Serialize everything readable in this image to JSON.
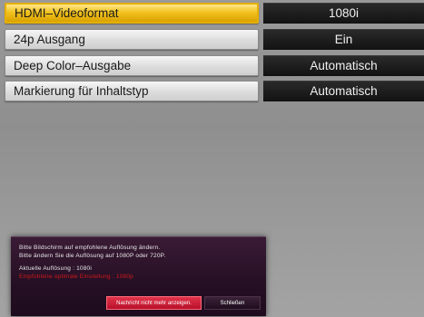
{
  "settings": [
    {
      "label": "HDMI–Videoformat",
      "value": "1080i",
      "selected": true
    },
    {
      "label": "24p Ausgang",
      "value": "Ein",
      "selected": false
    },
    {
      "label": "Deep Color–Ausgabe",
      "value": "Automatisch",
      "selected": false
    },
    {
      "label": "Markierung für Inhaltstyp",
      "value": "Automatisch",
      "selected": false
    }
  ],
  "dialog": {
    "line1": "Bitte Bildschirm auf empfohlene Auflösung ändern.",
    "line2": "Bitte ändern Sie die Auflösung auf 1080P oder 720P.",
    "current": "Aktuelle Auflösung : 1080i",
    "recommended": "Empfohlene optimale Einstellung : 1080p",
    "btn_dont_show": "Nachricht nicht mehr anzeigen.",
    "btn_close": "Schließen"
  },
  "colors": {
    "selection_yellow": "#f2c21f",
    "primary_button_red": "#c8142c",
    "recommended_text_red": "#d01818",
    "dialog_purple": "#2a1228"
  }
}
